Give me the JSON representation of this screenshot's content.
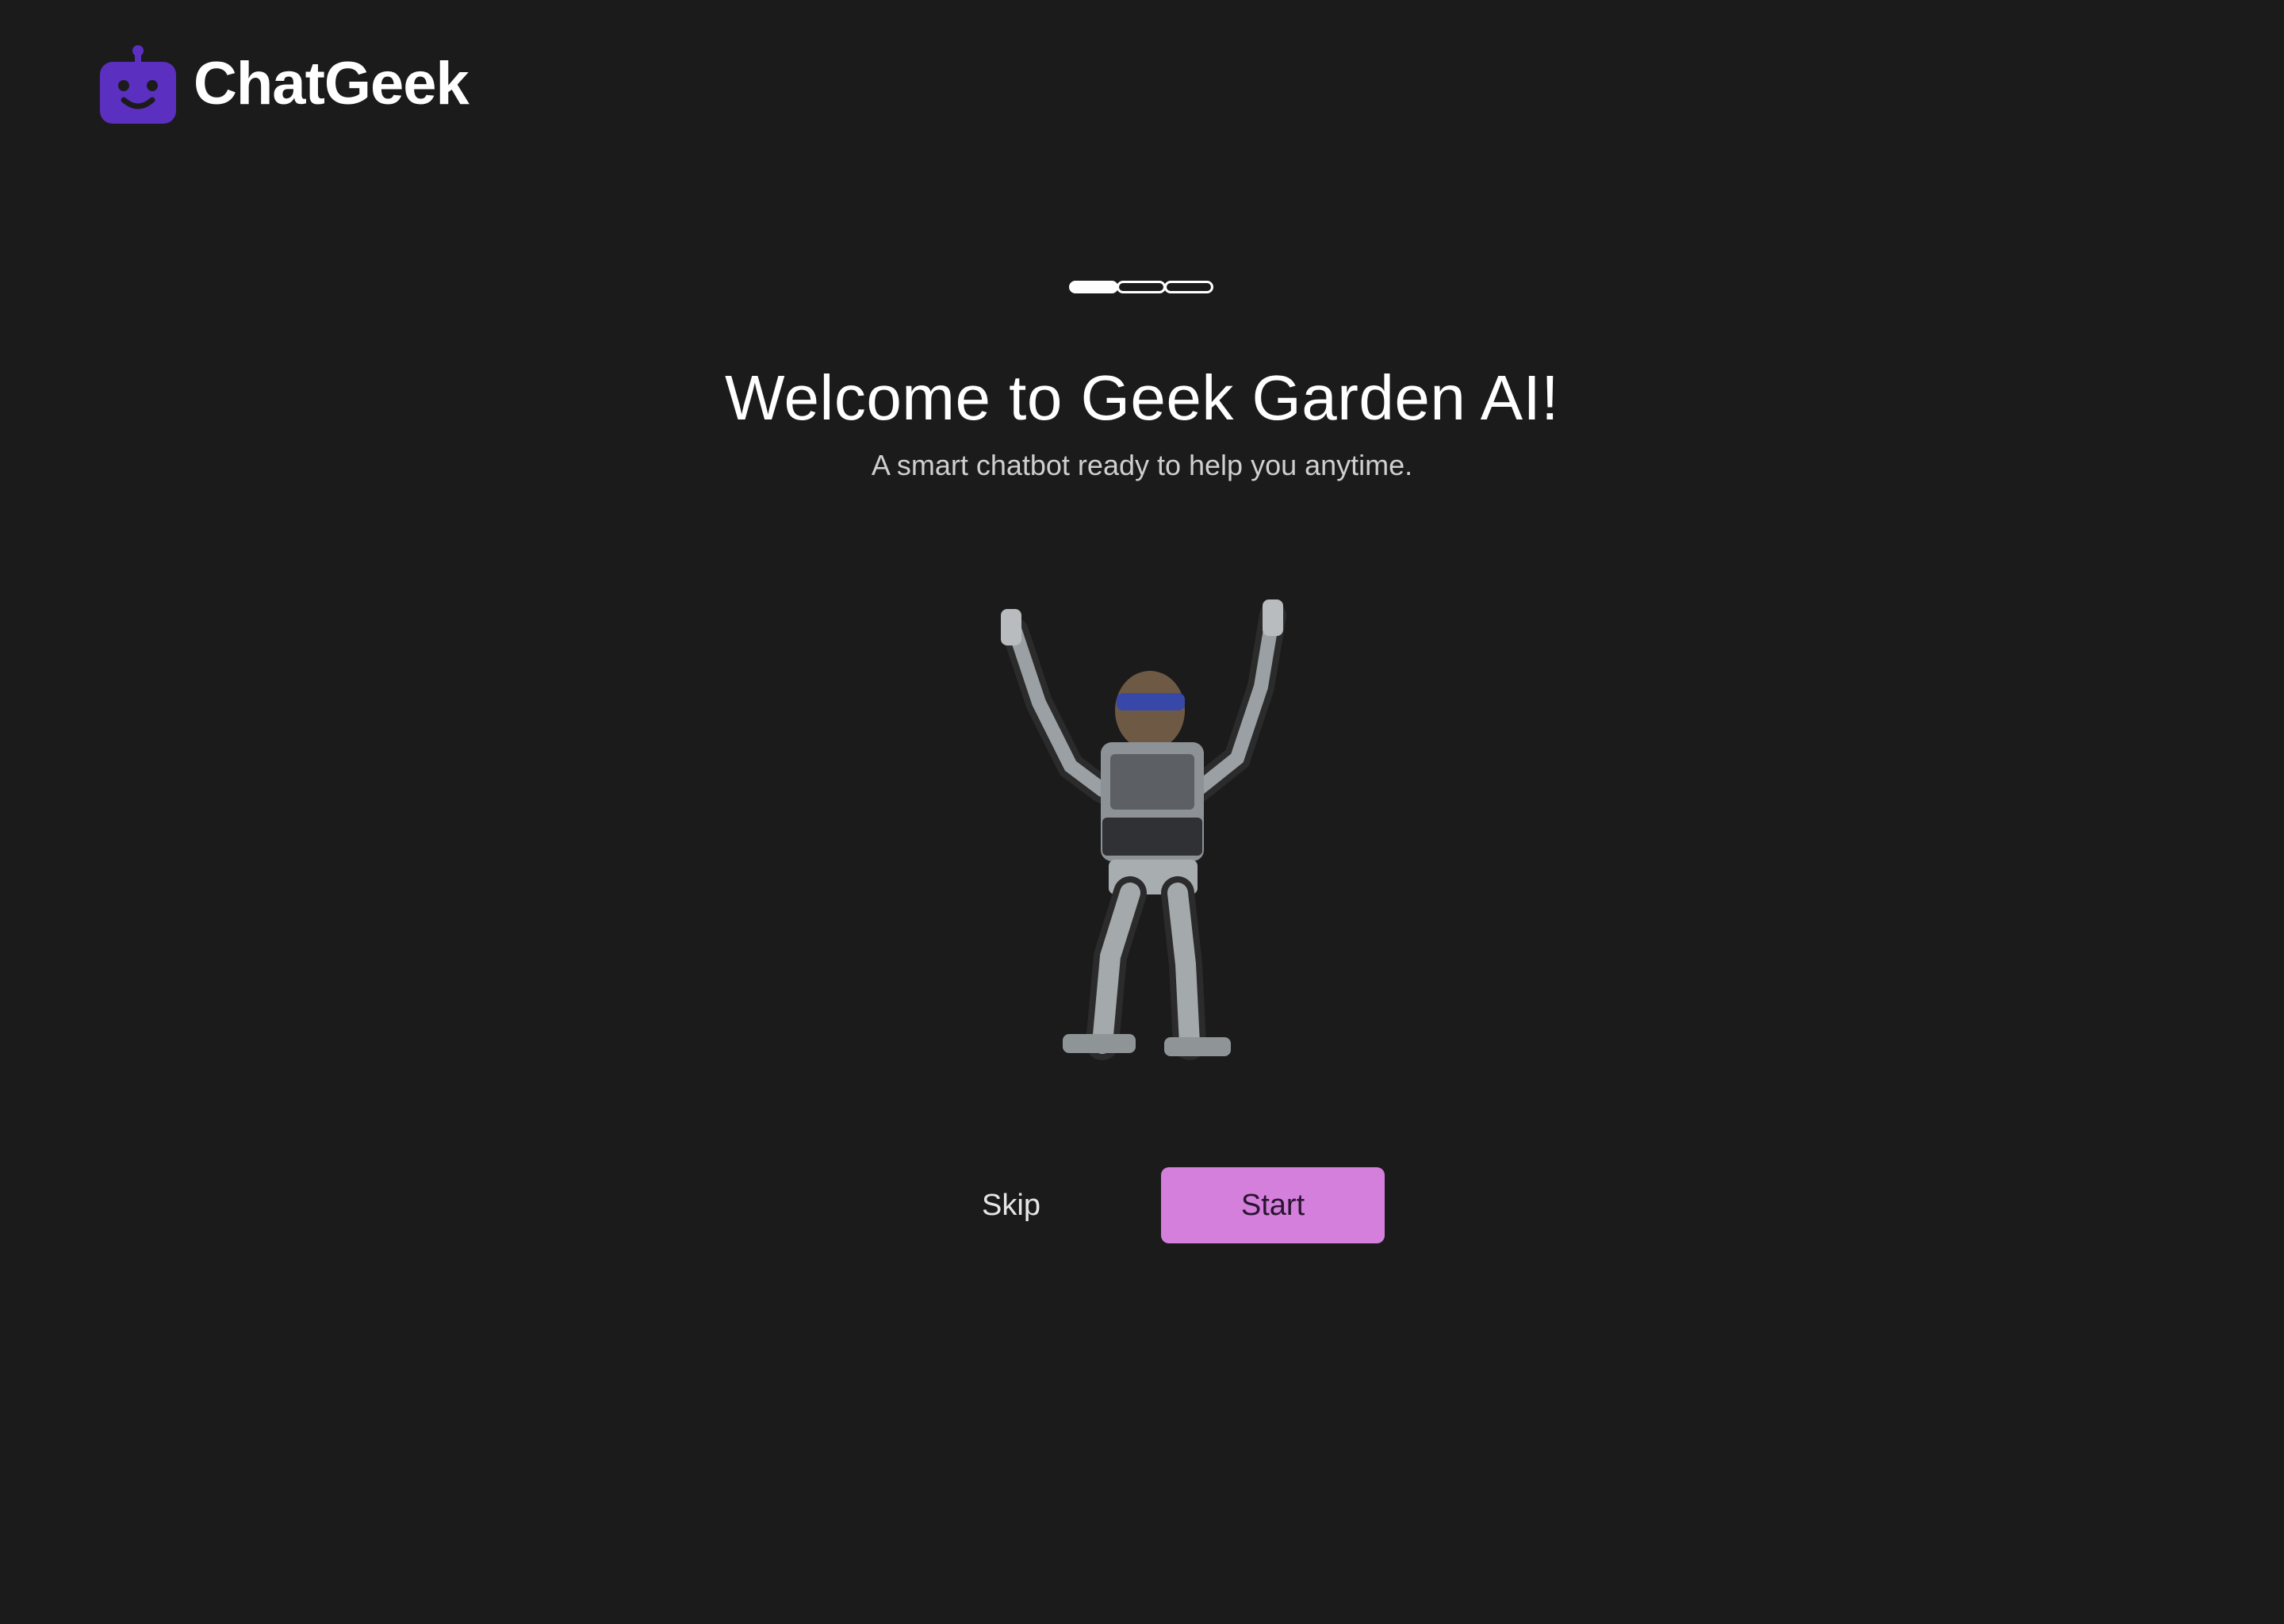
{
  "brand": {
    "name": "ChatGeek",
    "icon": "robot-face-icon",
    "color": "#5b2fc0"
  },
  "onboarding": {
    "step": 1,
    "total_steps": 3,
    "title": "Welcome to Geek Garden AI!",
    "subtitle": "A smart chatbot ready to help you anytime.",
    "illustration": "humanoid-robot-arms-raised"
  },
  "actions": {
    "skip_label": "Skip",
    "start_label": "Start",
    "start_color": "#d47fdc"
  },
  "colors": {
    "background": "#1c1b1c",
    "text": "#ffffff"
  }
}
